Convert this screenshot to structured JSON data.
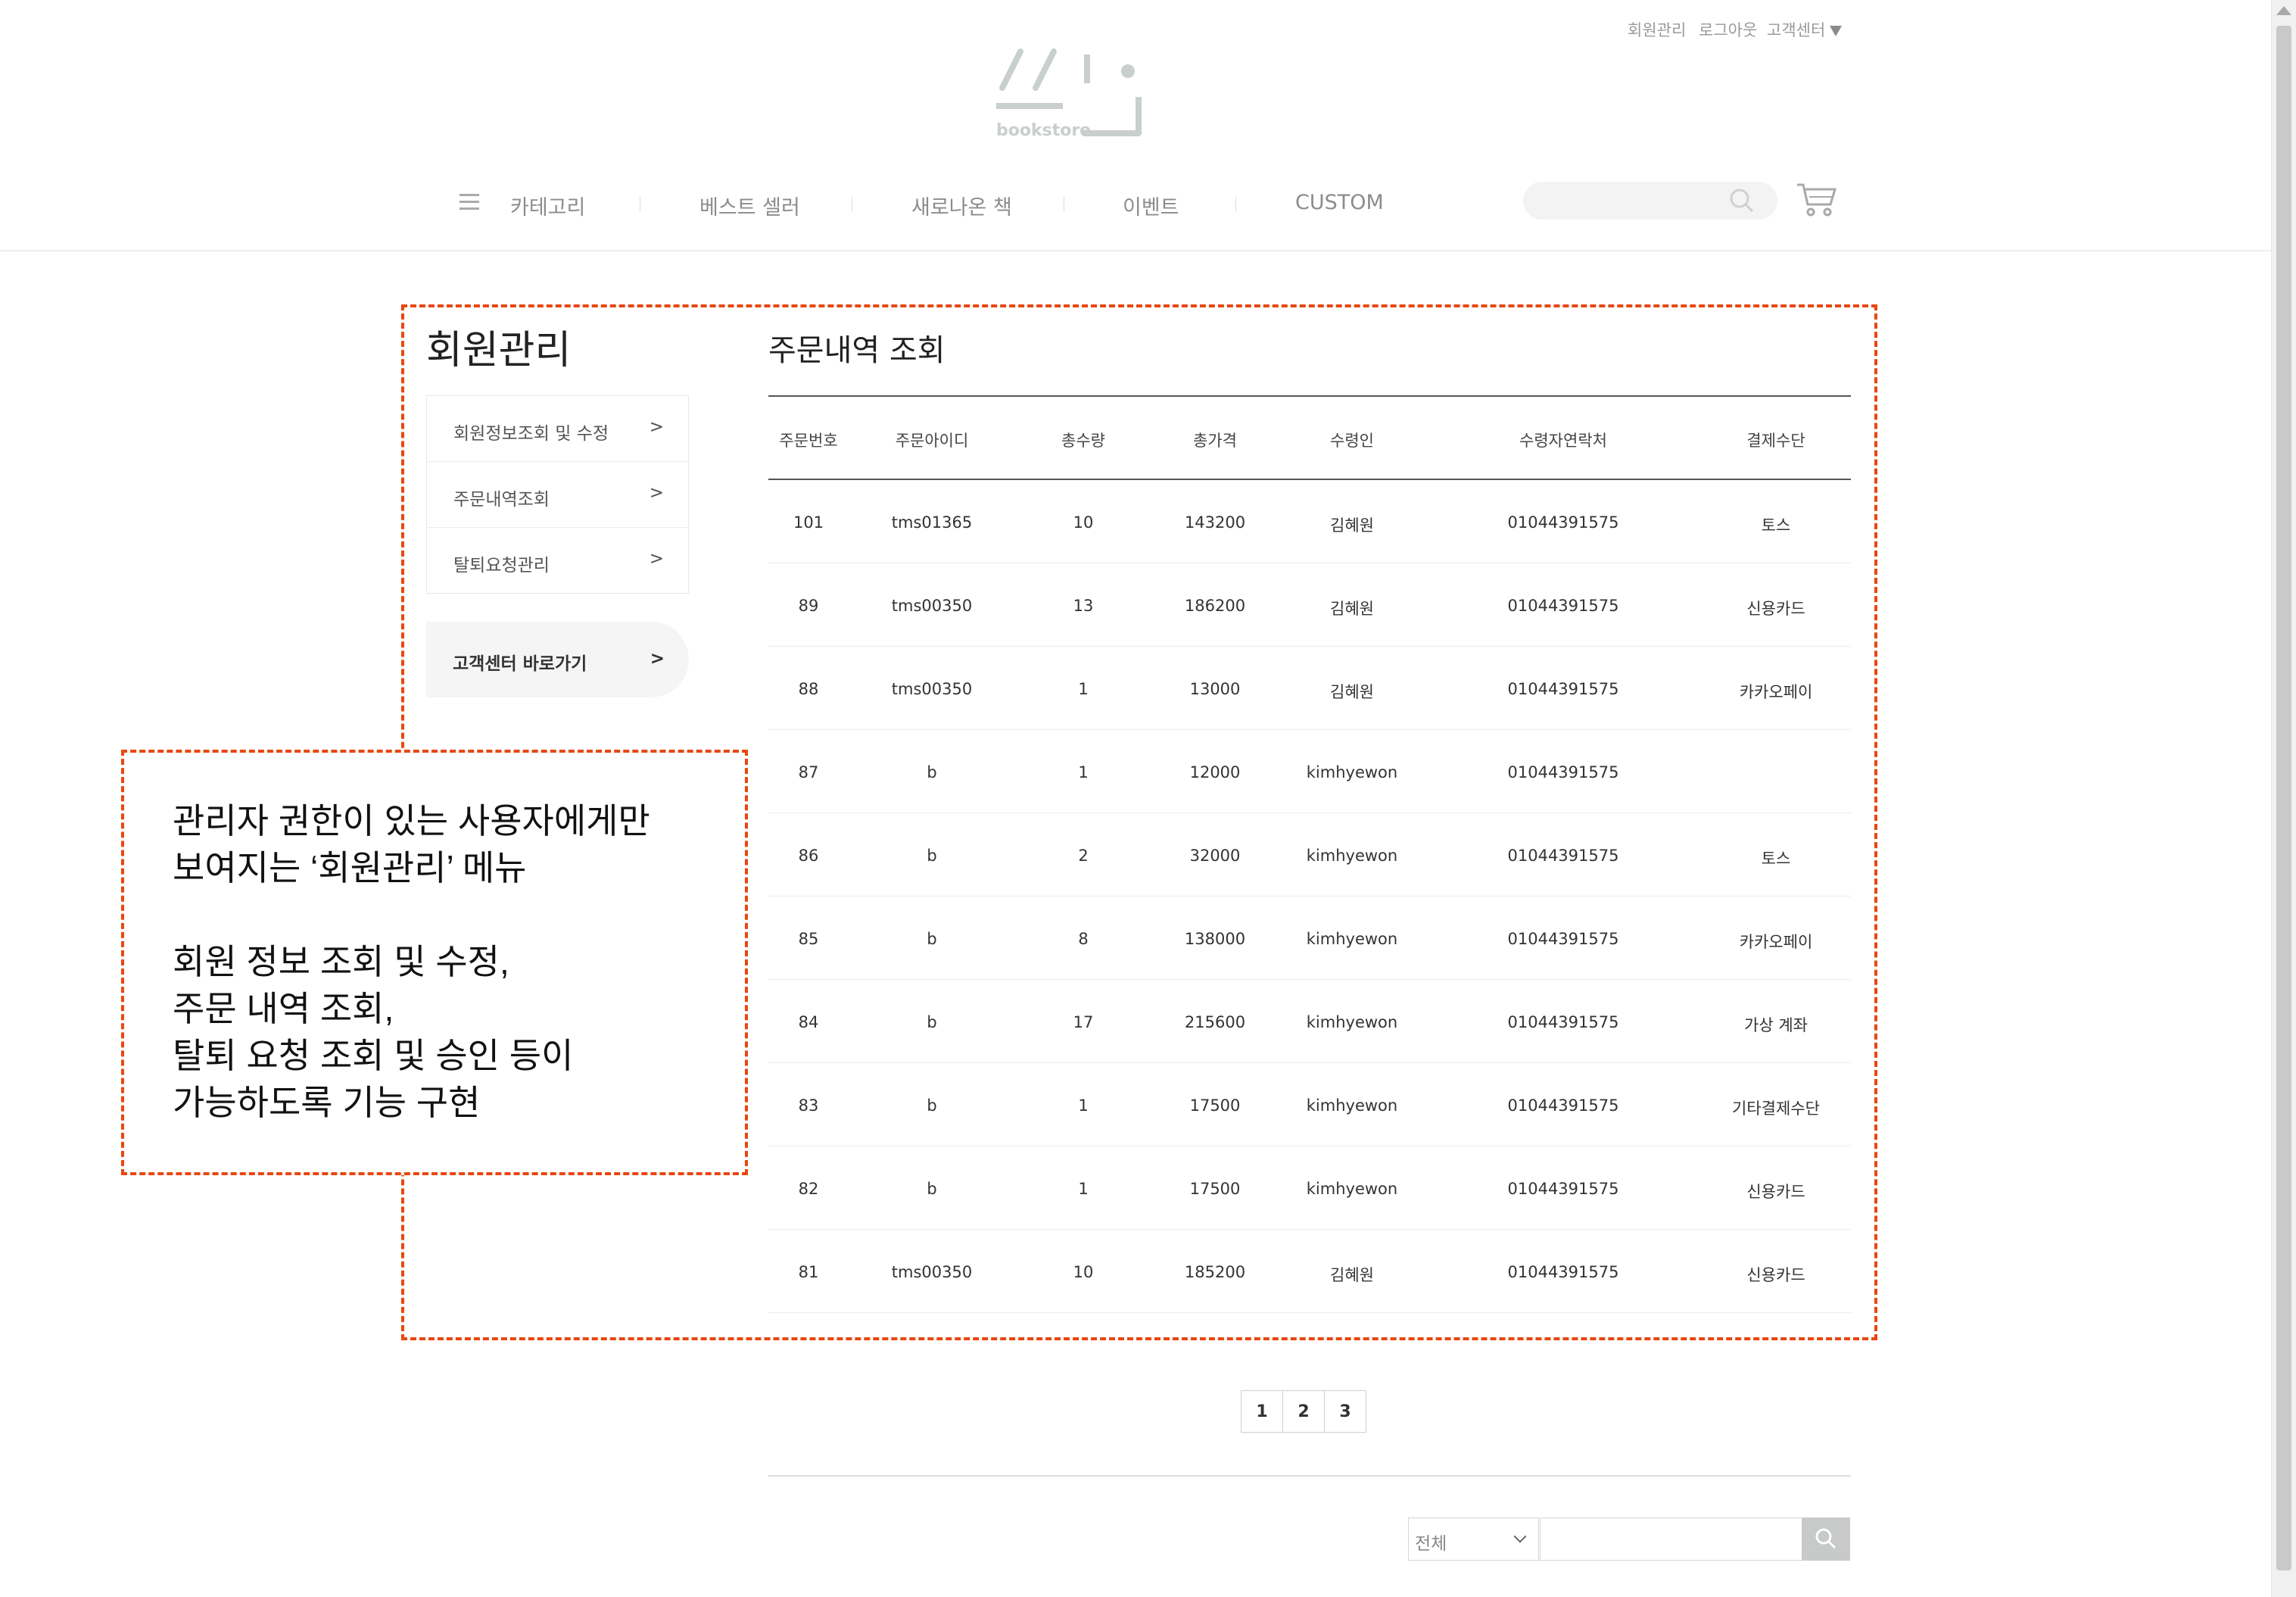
{
  "utility_links": [
    "회원관리",
    "로그아웃",
    "고객센터"
  ],
  "logo": {
    "text": "bookstore"
  },
  "nav": {
    "items": [
      "카테고리",
      "베스트 셀러",
      "새로나온 책",
      "이벤트",
      "CUSTOM"
    ],
    "icons": {
      "menu": "hamburger-icon",
      "search": "search-icon",
      "cart": "cart-icon"
    }
  },
  "sidebar": {
    "title": "회원관리",
    "items": [
      {
        "label": "회원정보조회 및 수정",
        "arrow": ">"
      },
      {
        "label": "주문내역조회",
        "arrow": ">"
      },
      {
        "label": "탈퇴요청관리",
        "arrow": ">"
      }
    ],
    "cs_link": {
      "label": "고객센터 바로가기",
      "arrow": ">"
    }
  },
  "main": {
    "title": "주문내역 조회",
    "columns": [
      "주문번호",
      "주문아이디",
      "총수량",
      "총가격",
      "수령인",
      "수령자연락처",
      "결제수단"
    ],
    "rows": [
      [
        "101",
        "tms01365",
        "10",
        "143200",
        "김혜원",
        "01044391575",
        "토스"
      ],
      [
        "89",
        "tms00350",
        "13",
        "186200",
        "김혜원",
        "01044391575",
        "신용카드"
      ],
      [
        "88",
        "tms00350",
        "1",
        "13000",
        "김혜원",
        "01044391575",
        "카카오페이"
      ],
      [
        "87",
        "b",
        "1",
        "12000",
        "kimhyewon",
        "01044391575",
        ""
      ],
      [
        "86",
        "b",
        "2",
        "32000",
        "kimhyewon",
        "01044391575",
        "토스"
      ],
      [
        "85",
        "b",
        "8",
        "138000",
        "kimhyewon",
        "01044391575",
        "카카오페이"
      ],
      [
        "84",
        "b",
        "17",
        "215600",
        "kimhyewon",
        "01044391575",
        "가상 계좌"
      ],
      [
        "83",
        "b",
        "1",
        "17500",
        "kimhyewon",
        "01044391575",
        "기타결제수단"
      ],
      [
        "82",
        "b",
        "1",
        "17500",
        "kimhyewon",
        "01044391575",
        "신용카드"
      ],
      [
        "81",
        "tms00350",
        "10",
        "185200",
        "김혜원",
        "01044391575",
        "신용카드"
      ]
    ]
  },
  "pagination": {
    "pages": [
      "1",
      "2",
      "3"
    ]
  },
  "search": {
    "select_value": "전체",
    "input_value": ""
  },
  "annotation": {
    "color": "#e8470f",
    "lines": [
      "관리자 권한이 있는 사용자에게만",
      "보여지는 ‘회원관리’ 메뉴",
      "회원 정보 조회 및 수정,",
      "주문 내역 조회,",
      "탈퇴 요청 조회 및 승인 등이",
      "가능하도록 기능 구현"
    ]
  }
}
